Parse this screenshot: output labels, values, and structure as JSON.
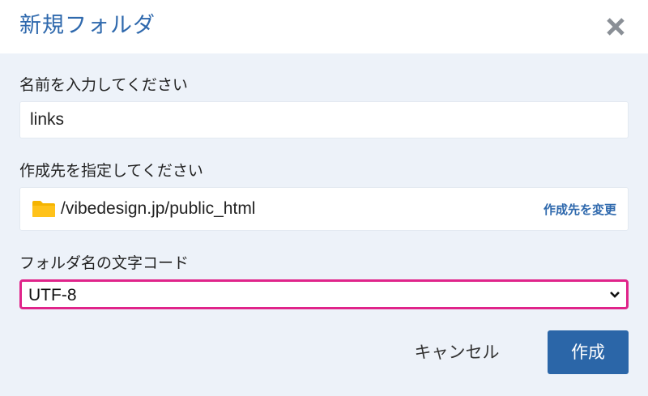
{
  "dialog": {
    "title": "新規フォルダ",
    "close_icon": "close-icon"
  },
  "name_field": {
    "label": "名前を入力してください",
    "value": "links"
  },
  "destination": {
    "label": "作成先を指定してください",
    "path": "/vibedesign.jp/public_html",
    "folder_icon": "folder-icon",
    "change_link": "作成先を変更"
  },
  "encoding": {
    "label": "フォルダ名の文字コード",
    "selected": "UTF-8",
    "chevron_icon": "chevron-down-icon"
  },
  "actions": {
    "cancel_label": "キャンセル",
    "create_label": "作成"
  },
  "colors": {
    "accent": "#2f69ad",
    "primary_button": "#2b66a8",
    "body_background": "#edf2f9",
    "highlight_border": "#e0248a",
    "folder": "#f5b400"
  }
}
